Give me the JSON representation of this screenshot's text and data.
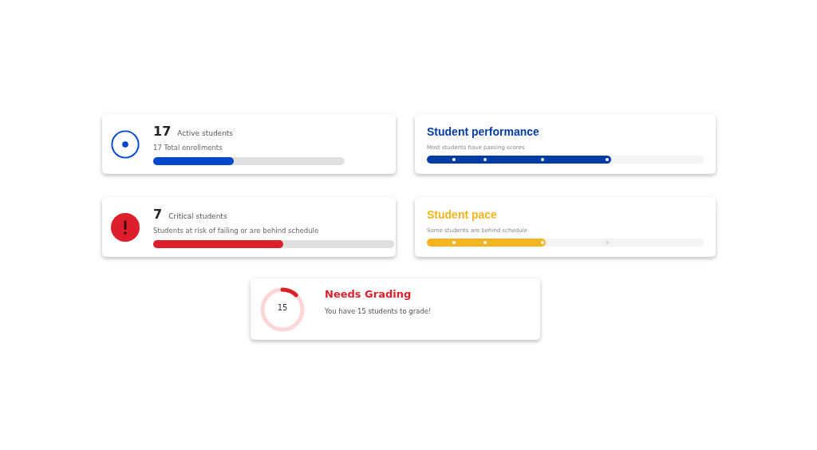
{
  "cards": [
    {
      "kind": "active",
      "color": "#0047cc",
      "value": "17",
      "label": "Active students",
      "subtitle": "17 Total enrollments",
      "level": 0.42
    },
    {
      "kind": "meter",
      "color": "#063da3",
      "title": "Student performance",
      "subtitle": "Most students have passing scores",
      "level": 0.665
    },
    {
      "kind": "critical",
      "color": "#dc1f2b",
      "value": "7",
      "label": "Critical students",
      "subtitle": "Students at risk of failing or are behind schedule",
      "level": 0.54
    },
    {
      "kind": "meter",
      "color": "#f2b51f",
      "title": "Student pace",
      "subtitle": "Some students are behind schedule",
      "level": 0.43
    }
  ],
  "grading": {
    "value": "15",
    "title": "Needs Grading",
    "subtitle": "You have 15 students to grade!",
    "level": 0.12
  }
}
